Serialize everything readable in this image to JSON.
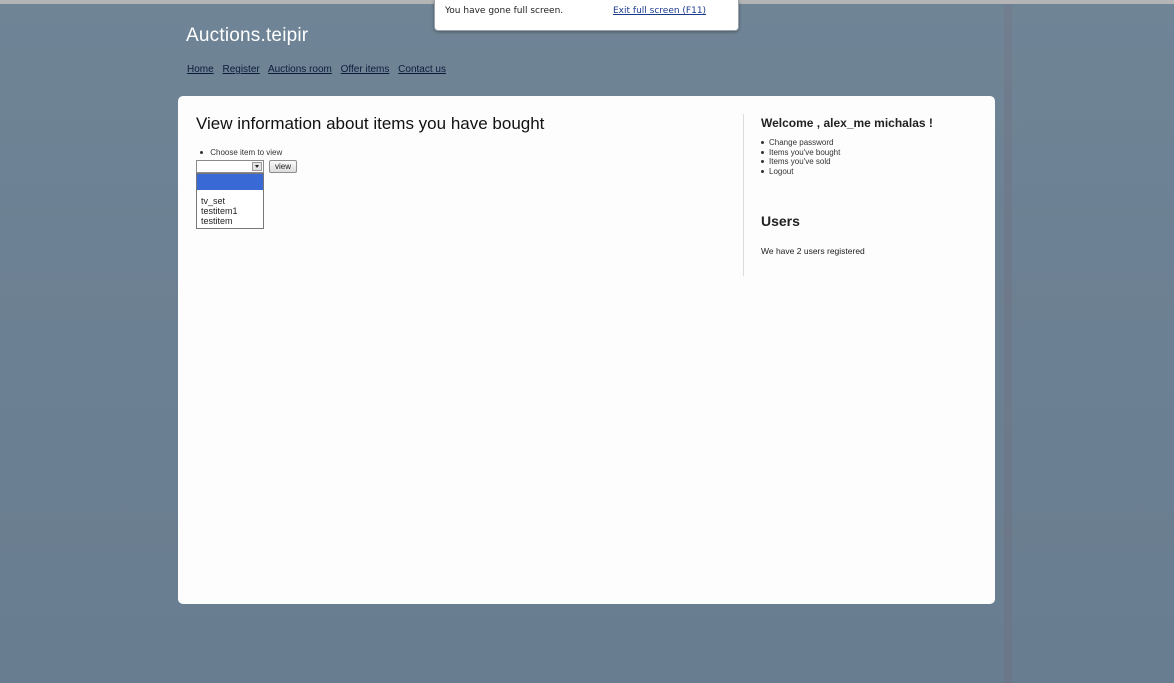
{
  "fullscreen_notice": {
    "message": "You have gone full screen.",
    "exit_link": "Exit full screen (F11)"
  },
  "site": {
    "title": "Auctions.teipir",
    "nav": [
      "Home",
      "Register",
      "Auctions room",
      "Offer items",
      "Contact us"
    ]
  },
  "main": {
    "heading": "View information about items you have bought",
    "choose_label": "Choose item to view",
    "select_value": "",
    "view_button": "view",
    "dropdown_options": [
      "",
      "tv_set",
      "testitem1",
      "testitem"
    ]
  },
  "sidebar": {
    "welcome": "Welcome , alex_me michalas !",
    "links": [
      "Change password",
      "Items you've bought",
      "Items you've sold",
      "Logout"
    ],
    "users_heading": "Users",
    "users_text": "We have 2 users registered"
  },
  "colors": {
    "background": "#6c8193",
    "panel": "#fdfdfd",
    "selected_option": "#3869d4"
  }
}
